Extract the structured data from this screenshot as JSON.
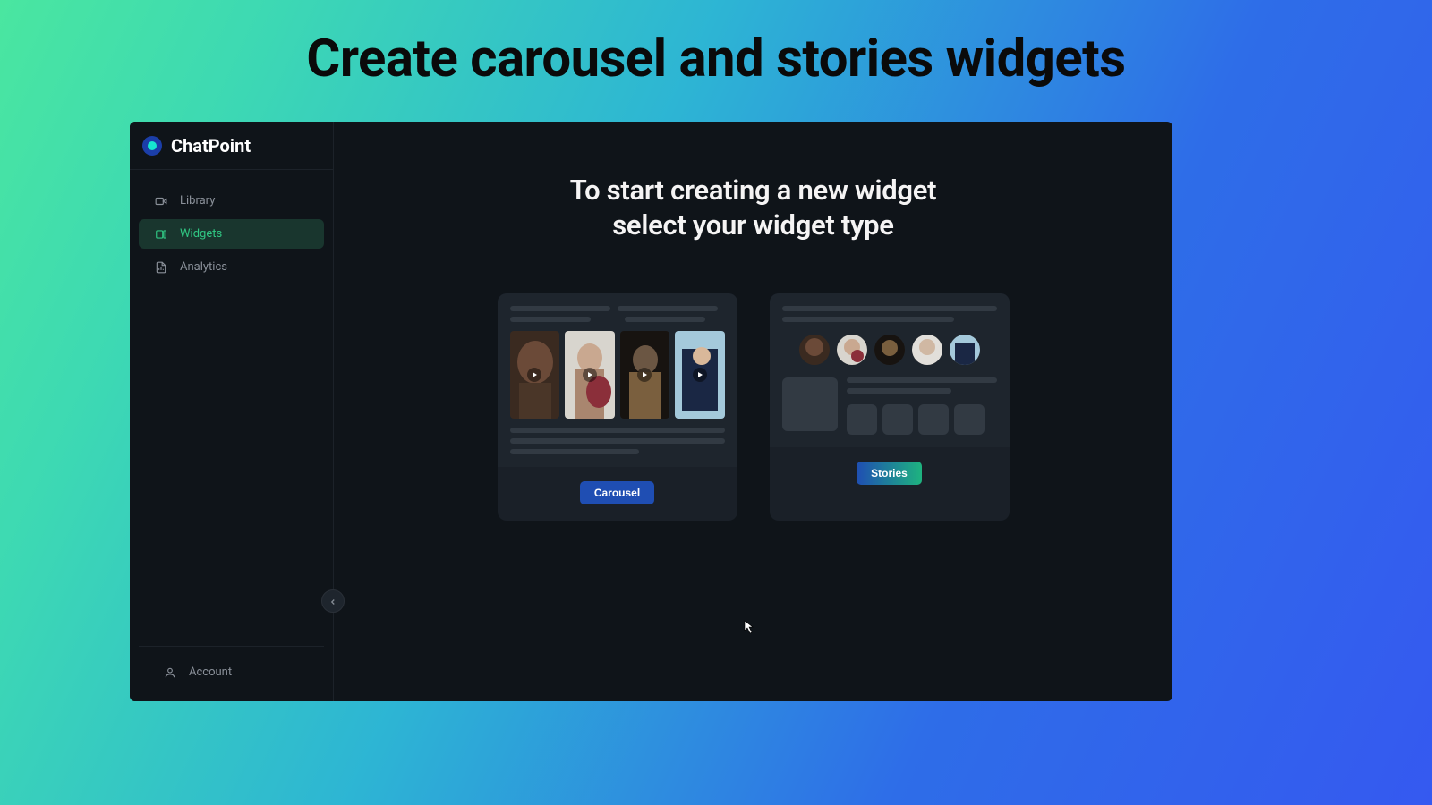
{
  "page": {
    "title": "Create carousel and stories widgets"
  },
  "brand": {
    "name": "ChatPoint"
  },
  "sidebar": {
    "items": [
      {
        "label": "Library",
        "icon": "video"
      },
      {
        "label": "Widgets",
        "icon": "widgets",
        "active": true
      },
      {
        "label": "Analytics",
        "icon": "analytics"
      }
    ],
    "account_label": "Account"
  },
  "main": {
    "heading_line1": "To start creating a new widget",
    "heading_line2": "select your widget type"
  },
  "widget_types": {
    "carousel_label": "Carousel",
    "stories_label": "Stories"
  }
}
